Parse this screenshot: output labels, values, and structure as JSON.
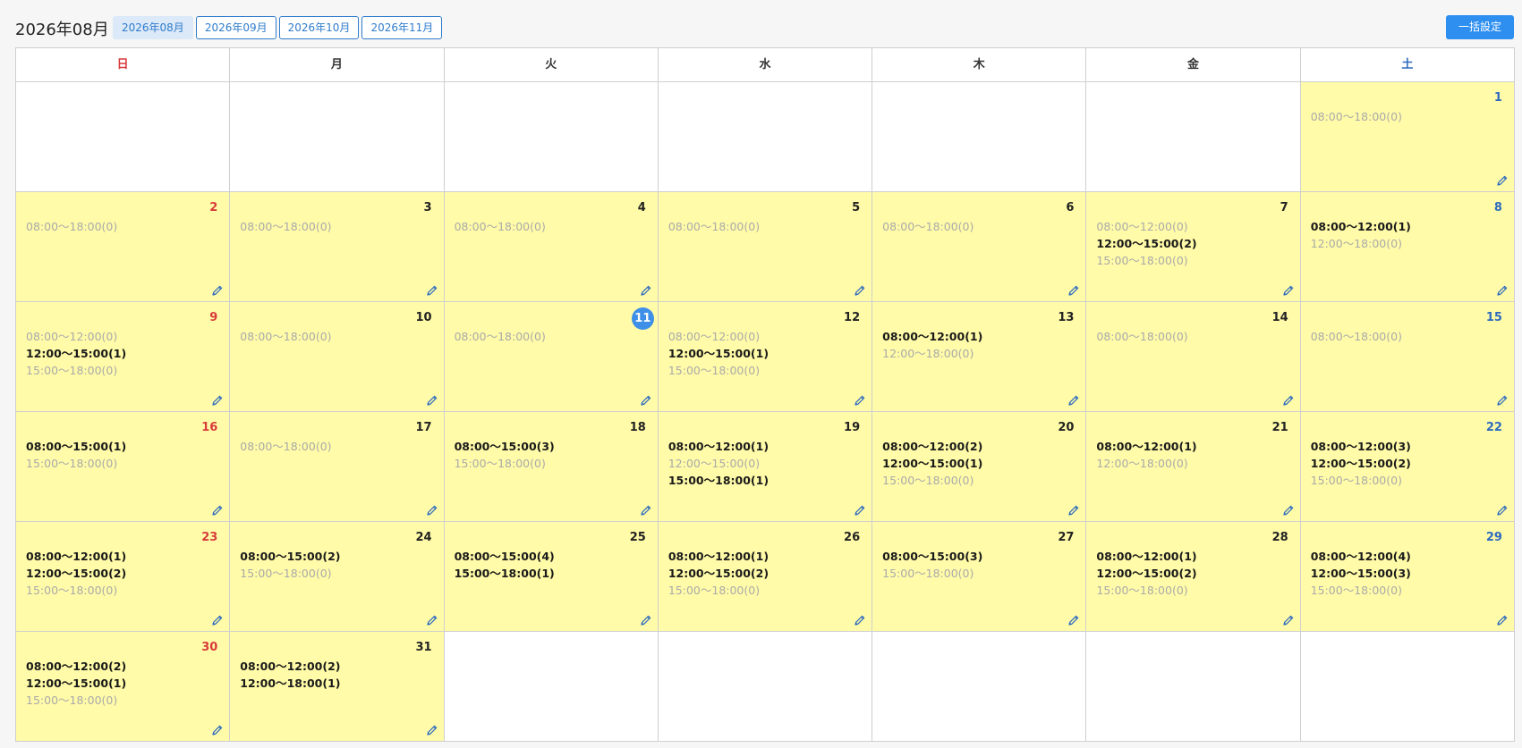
{
  "header": {
    "title": "2026年08月",
    "tabs": [
      {
        "label": "2026年08月",
        "active": true
      },
      {
        "label": "2026年09月",
        "active": false
      },
      {
        "label": "2026年10月",
        "active": false
      },
      {
        "label": "2026年11月",
        "active": false
      }
    ],
    "bulk_button_label": "一括設定"
  },
  "colors": {
    "accent": "#2e8ff0",
    "day_background": "#fffba8",
    "sunday": "#d83b3b",
    "saturday": "#2f6bbf"
  },
  "weekdays": [
    "日",
    "月",
    "火",
    "水",
    "木",
    "金",
    "土"
  ],
  "today": 11,
  "weeks": [
    [
      null,
      null,
      null,
      null,
      null,
      null,
      {
        "day": "1",
        "slots": [
          {
            "text": "08:00〜18:00(0)",
            "booked": false
          }
        ]
      }
    ],
    [
      {
        "day": "2",
        "slots": [
          {
            "text": "08:00〜18:00(0)",
            "booked": false
          }
        ]
      },
      {
        "day": "3",
        "slots": [
          {
            "text": "08:00〜18:00(0)",
            "booked": false
          }
        ]
      },
      {
        "day": "4",
        "slots": [
          {
            "text": "08:00〜18:00(0)",
            "booked": false
          }
        ]
      },
      {
        "day": "5",
        "slots": [
          {
            "text": "08:00〜18:00(0)",
            "booked": false
          }
        ]
      },
      {
        "day": "6",
        "slots": [
          {
            "text": "08:00〜18:00(0)",
            "booked": false
          }
        ]
      },
      {
        "day": "7",
        "slots": [
          {
            "text": "08:00〜12:00(0)",
            "booked": false
          },
          {
            "text": "12:00〜15:00(2)",
            "booked": true
          },
          {
            "text": "15:00〜18:00(0)",
            "booked": false
          }
        ]
      },
      {
        "day": "8",
        "slots": [
          {
            "text": "08:00〜12:00(1)",
            "booked": true
          },
          {
            "text": "12:00〜18:00(0)",
            "booked": false
          }
        ]
      }
    ],
    [
      {
        "day": "9",
        "slots": [
          {
            "text": "08:00〜12:00(0)",
            "booked": false
          },
          {
            "text": "12:00〜15:00(1)",
            "booked": true
          },
          {
            "text": "15:00〜18:00(0)",
            "booked": false
          }
        ]
      },
      {
        "day": "10",
        "slots": [
          {
            "text": "08:00〜18:00(0)",
            "booked": false
          }
        ]
      },
      {
        "day": "11",
        "slots": [
          {
            "text": "08:00〜18:00(0)",
            "booked": false
          }
        ]
      },
      {
        "day": "12",
        "slots": [
          {
            "text": "08:00〜12:00(0)",
            "booked": false
          },
          {
            "text": "12:00〜15:00(1)",
            "booked": true
          },
          {
            "text": "15:00〜18:00(0)",
            "booked": false
          }
        ]
      },
      {
        "day": "13",
        "slots": [
          {
            "text": "08:00〜12:00(1)",
            "booked": true
          },
          {
            "text": "12:00〜18:00(0)",
            "booked": false
          }
        ]
      },
      {
        "day": "14",
        "slots": [
          {
            "text": "08:00〜18:00(0)",
            "booked": false
          }
        ]
      },
      {
        "day": "15",
        "slots": [
          {
            "text": "08:00〜18:00(0)",
            "booked": false
          }
        ]
      }
    ],
    [
      {
        "day": "16",
        "slots": [
          {
            "text": "08:00〜15:00(1)",
            "booked": true
          },
          {
            "text": "15:00〜18:00(0)",
            "booked": false
          }
        ]
      },
      {
        "day": "17",
        "slots": [
          {
            "text": "08:00〜18:00(0)",
            "booked": false
          }
        ]
      },
      {
        "day": "18",
        "slots": [
          {
            "text": "08:00〜15:00(3)",
            "booked": true
          },
          {
            "text": "15:00〜18:00(0)",
            "booked": false
          }
        ]
      },
      {
        "day": "19",
        "slots": [
          {
            "text": "08:00〜12:00(1)",
            "booked": true
          },
          {
            "text": "12:00〜15:00(0)",
            "booked": false
          },
          {
            "text": "15:00〜18:00(1)",
            "booked": true
          }
        ]
      },
      {
        "day": "20",
        "slots": [
          {
            "text": "08:00〜12:00(2)",
            "booked": true
          },
          {
            "text": "12:00〜15:00(1)",
            "booked": true
          },
          {
            "text": "15:00〜18:00(0)",
            "booked": false
          }
        ]
      },
      {
        "day": "21",
        "slots": [
          {
            "text": "08:00〜12:00(1)",
            "booked": true
          },
          {
            "text": "12:00〜18:00(0)",
            "booked": false
          }
        ]
      },
      {
        "day": "22",
        "slots": [
          {
            "text": "08:00〜12:00(3)",
            "booked": true
          },
          {
            "text": "12:00〜15:00(2)",
            "booked": true
          },
          {
            "text": "15:00〜18:00(0)",
            "booked": false
          }
        ]
      }
    ],
    [
      {
        "day": "23",
        "slots": [
          {
            "text": "08:00〜12:00(1)",
            "booked": true
          },
          {
            "text": "12:00〜15:00(2)",
            "booked": true
          },
          {
            "text": "15:00〜18:00(0)",
            "booked": false
          }
        ]
      },
      {
        "day": "24",
        "slots": [
          {
            "text": "08:00〜15:00(2)",
            "booked": true
          },
          {
            "text": "15:00〜18:00(0)",
            "booked": false
          }
        ]
      },
      {
        "day": "25",
        "slots": [
          {
            "text": "08:00〜15:00(4)",
            "booked": true
          },
          {
            "text": "15:00〜18:00(1)",
            "booked": true
          }
        ]
      },
      {
        "day": "26",
        "slots": [
          {
            "text": "08:00〜12:00(1)",
            "booked": true
          },
          {
            "text": "12:00〜15:00(2)",
            "booked": true
          },
          {
            "text": "15:00〜18:00(0)",
            "booked": false
          }
        ]
      },
      {
        "day": "27",
        "slots": [
          {
            "text": "08:00〜15:00(3)",
            "booked": true
          },
          {
            "text": "15:00〜18:00(0)",
            "booked": false
          }
        ]
      },
      {
        "day": "28",
        "slots": [
          {
            "text": "08:00〜12:00(1)",
            "booked": true
          },
          {
            "text": "12:00〜15:00(2)",
            "booked": true
          },
          {
            "text": "15:00〜18:00(0)",
            "booked": false
          }
        ]
      },
      {
        "day": "29",
        "slots": [
          {
            "text": "08:00〜12:00(4)",
            "booked": true
          },
          {
            "text": "12:00〜15:00(3)",
            "booked": true
          },
          {
            "text": "15:00〜18:00(0)",
            "booked": false
          }
        ]
      }
    ],
    [
      {
        "day": "30",
        "slots": [
          {
            "text": "08:00〜12:00(2)",
            "booked": true
          },
          {
            "text": "12:00〜15:00(1)",
            "booked": true
          },
          {
            "text": "15:00〜18:00(0)",
            "booked": false
          }
        ]
      },
      {
        "day": "31",
        "slots": [
          {
            "text": "08:00〜12:00(2)",
            "booked": true
          },
          {
            "text": "12:00〜18:00(1)",
            "booked": true
          }
        ]
      },
      null,
      null,
      null,
      null,
      null
    ]
  ]
}
